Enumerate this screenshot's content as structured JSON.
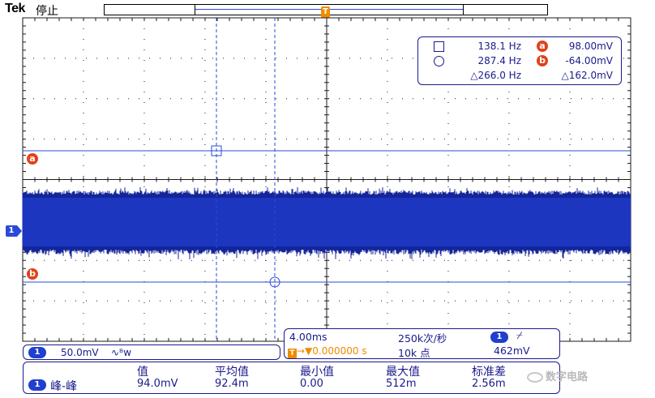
{
  "header": {
    "brand": "Tek",
    "run_state": "停止"
  },
  "trigger_marker": "T",
  "cursor_readout": {
    "cursor1_freq": "138.1 Hz",
    "cursor1_volt": "98.00mV",
    "cursor2_freq": "287.4 Hz",
    "cursor2_volt": "-64.00mV",
    "delta_freq": "△266.0 Hz",
    "delta_volt": "△162.0mV",
    "badge_a": "a",
    "badge_b": "b"
  },
  "markers": {
    "a": "a",
    "b": "b",
    "ch1": "1"
  },
  "channel": {
    "number": "1",
    "volts_per_div": "50.0mV",
    "bw_icon": "∿ᴮw"
  },
  "timebase": {
    "time_per_div": "4.00ms",
    "sample_rate": "250k次/秒",
    "trigger_channel": "1",
    "trigger_slope": "⌿",
    "trigger_position": "0.000000 s",
    "record_length": "10k 点",
    "trigger_level": "462mV"
  },
  "measurements": {
    "headers": [
      "值",
      "平均值",
      "最小值",
      "最大值",
      "标准差"
    ],
    "channel": "1",
    "name": "峰-峰",
    "values": [
      "94.0mV",
      "92.4m",
      "0.00",
      "512m",
      "2.56m"
    ]
  },
  "watermark": "数字电路",
  "colors": {
    "grid": "#1a1a1a",
    "trace": "#1f3fcf",
    "cursor": "#2a4bd7",
    "accent_orange": "#f08b00",
    "badge_red": "#e0421b"
  }
}
